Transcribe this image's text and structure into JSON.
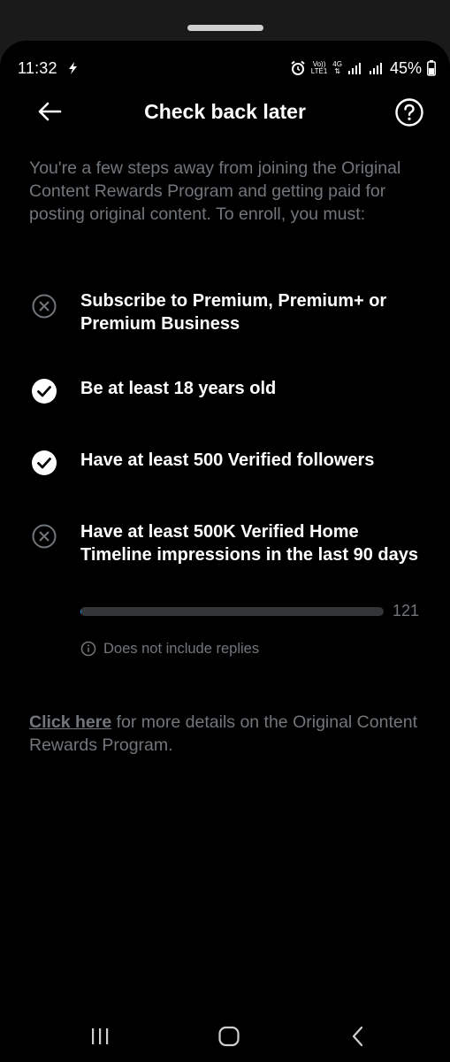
{
  "status_bar": {
    "time": "11:32",
    "volte_top": "Vo))",
    "volte_bottom": "LTE1",
    "network": "4G",
    "battery": "45%"
  },
  "header": {
    "title": "Check back later"
  },
  "intro": {
    "text": "You're a few steps away from joining the Original Content Rewards Program and getting paid for posting original content. To enroll, you must:"
  },
  "requirements": [
    {
      "text": "Subscribe to Premium, Premium+ or Premium Business",
      "met": false
    },
    {
      "text": "Be at least 18 years old",
      "met": true
    },
    {
      "text": "Have at least 500 Verified followers",
      "met": true
    },
    {
      "text": "Have at least 500K Verified Home Timeline impressions in the last 90 days",
      "met": false
    }
  ],
  "impressions": {
    "value_label": "121",
    "progress_fraction": 0.000242,
    "note": "Does not include replies"
  },
  "footer": {
    "link_text": "Click here",
    "rest_text": " for more details on the Original Content Rewards Program."
  },
  "colors": {
    "background": "#000000",
    "text_primary": "#ffffff",
    "text_secondary": "#71767b",
    "progress_track": "#333639",
    "accent": "#1d9bf0"
  }
}
